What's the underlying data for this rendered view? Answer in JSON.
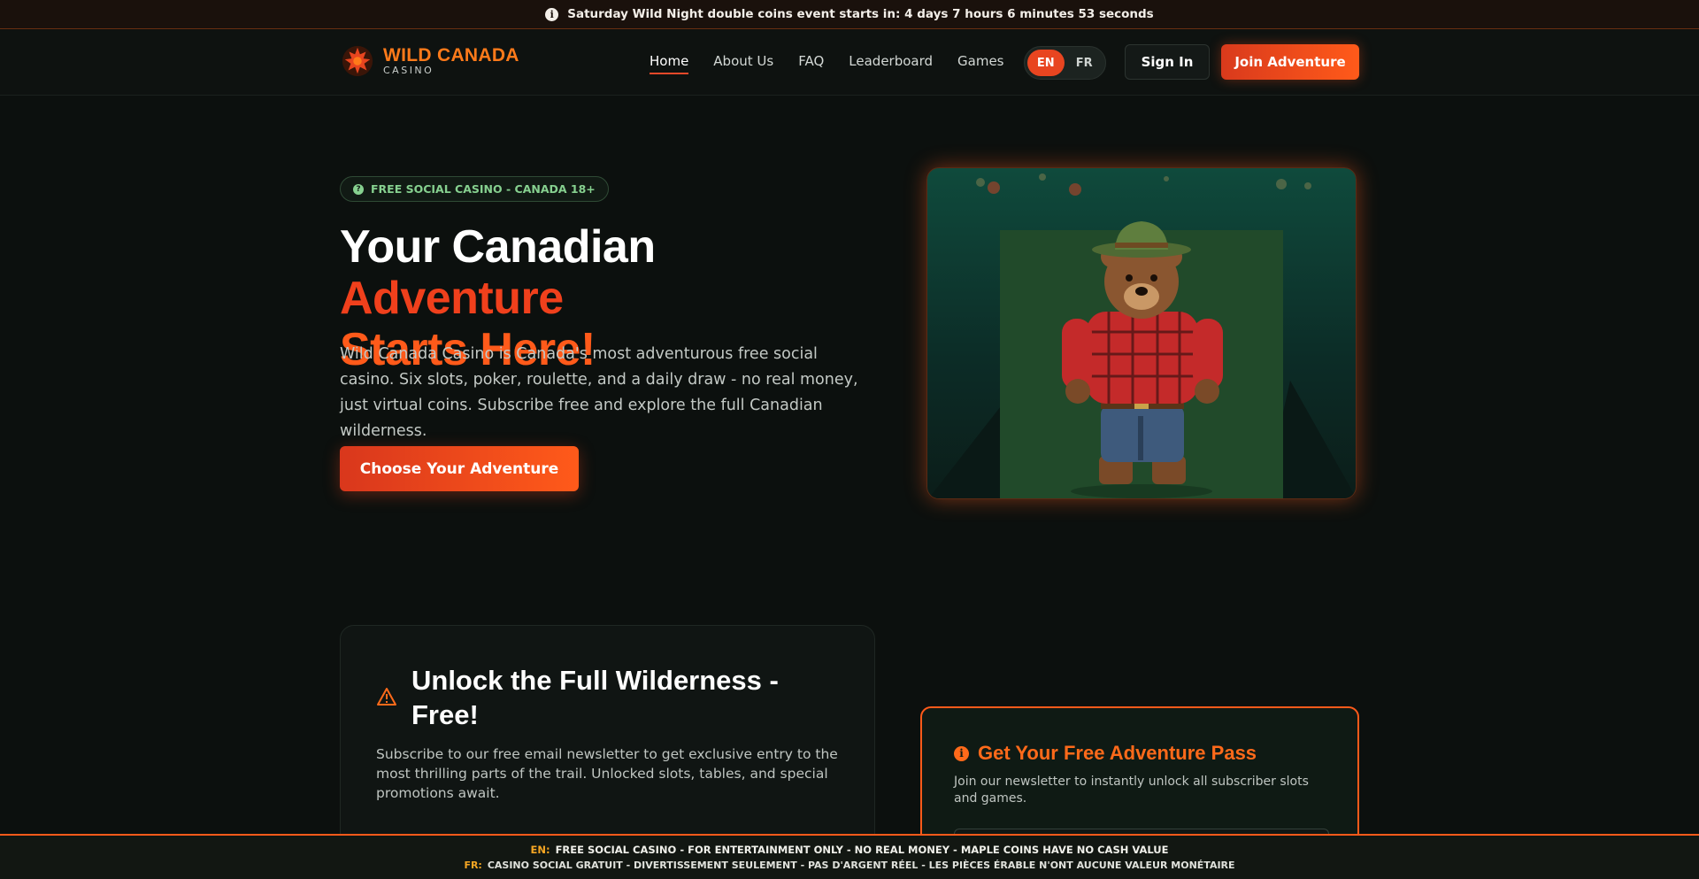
{
  "announcement": {
    "text": "Saturday Wild Night double coins event starts in: 4 days 7 hours 6 minutes 53 seconds",
    "icon": "info-icon"
  },
  "brand": {
    "name": "WILD CANADA",
    "sub": "CASINO",
    "accent": "#ff7a1a"
  },
  "nav": {
    "items": [
      {
        "label": "Home"
      },
      {
        "label": "About Us"
      },
      {
        "label": "FAQ"
      },
      {
        "label": "Leaderboard"
      },
      {
        "label": "Games"
      }
    ],
    "active": "Home"
  },
  "language": {
    "options": [
      "EN",
      "FR"
    ],
    "selected": "EN"
  },
  "header_buttons": {
    "sign_in": "Sign In",
    "join": "Join Adventure"
  },
  "hero": {
    "badge": "FREE SOCIAL CASINO - CANADA 18+",
    "title_part1": "Your Canadian ",
    "title_part2": "Adventure",
    "title_part3": "Starts Here!",
    "description": "Wild Canada Casino is Canada's most adventurous free social casino. Six slots, poker, roulette, and a daily draw - no real money, just virtual coins. Subscribe free and explore the full Canadian wilderness.",
    "cta": "Choose Your Adventure",
    "image_subject": "bear in plaid ranger outfit"
  },
  "unlock": {
    "title": "Unlock the Full Wilderness - Free!",
    "description": "Subscribe to our free email newsletter to get exclusive entry to the most thrilling parts of the trail. Unlocked slots, tables, and special promotions await."
  },
  "pass": {
    "title": "Get Your Free Adventure Pass",
    "description": "Join our newsletter to instantly unlock all subscriber slots and games."
  },
  "disclaimer": {
    "en_tag": "EN:",
    "en_text": "FREE SOCIAL CASINO - FOR ENTERTAINMENT ONLY - NO REAL MONEY - MAPLE COINS HAVE NO CASH VALUE",
    "fr_tag": "FR:",
    "fr_text": "CASINO SOCIAL GRATUIT - DIVERTISSEMENT SEULEMENT - PAS D'ARGENT RÉEL - LES PIÈCES ÉRABLE N'ONT AUCUNE VALEUR MONÉTAIRE"
  },
  "colors": {
    "primary": "#ff5a1a",
    "primary_dark": "#d9371c",
    "background": "#0c100e",
    "badge_green": "#86d08f"
  }
}
